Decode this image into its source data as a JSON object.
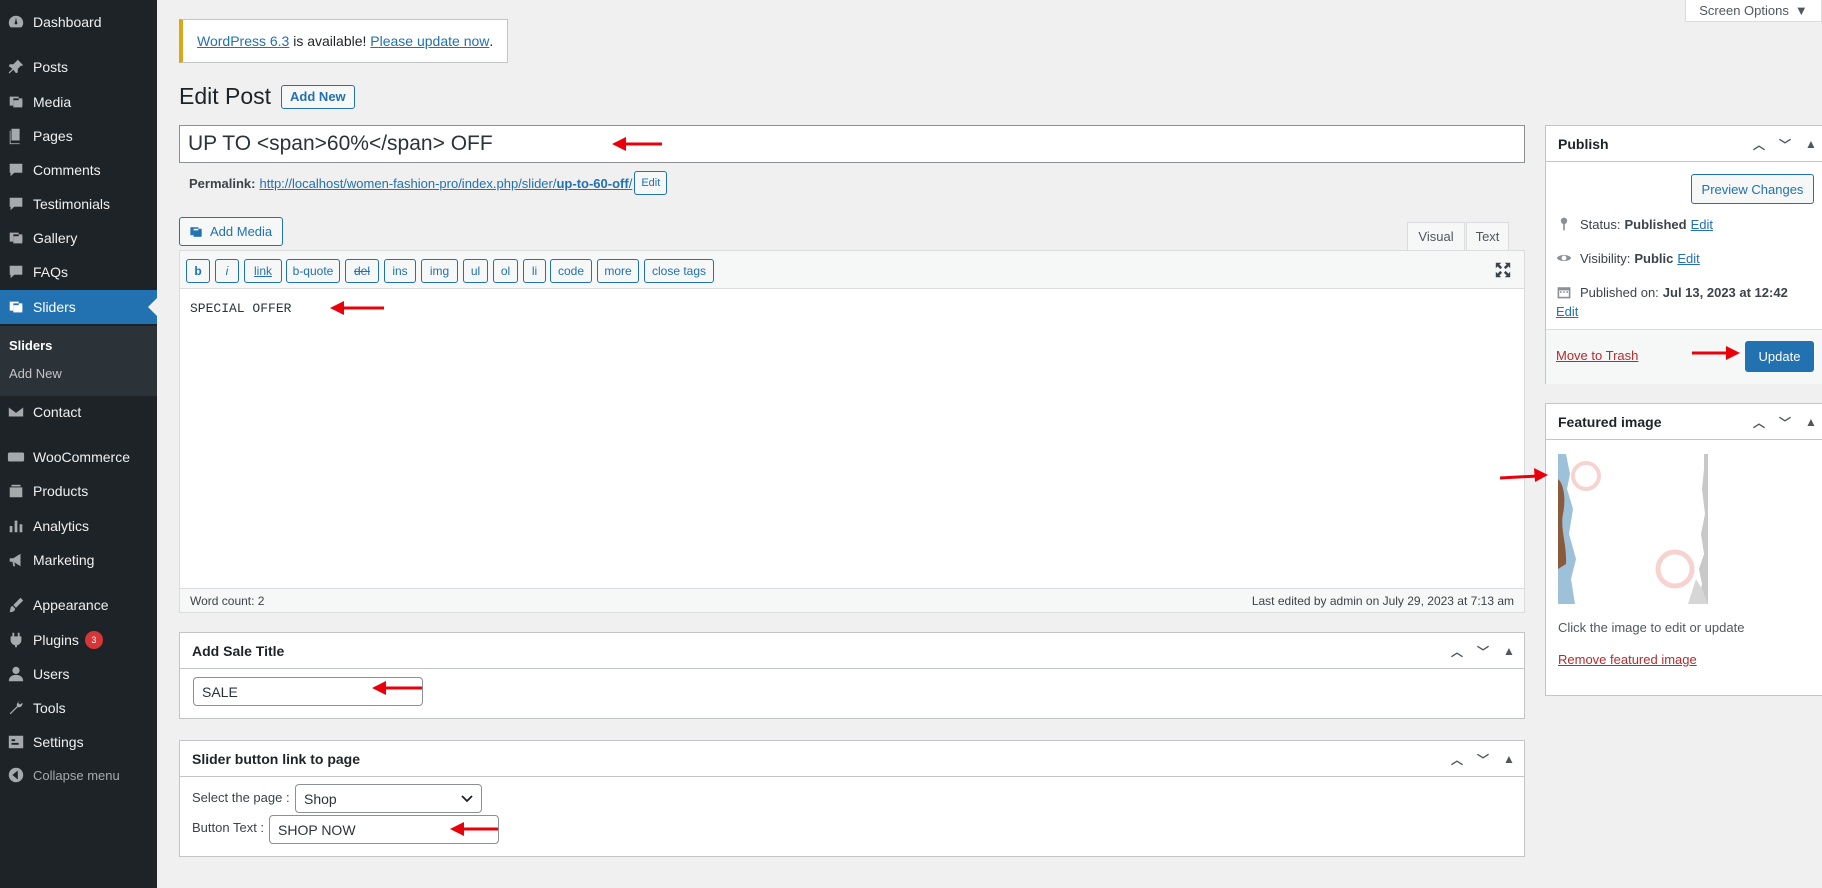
{
  "sidebar": {
    "items": [
      {
        "label": "Dashboard",
        "icon": "dashboard-icon"
      },
      {
        "label": "Posts",
        "icon": "pin-icon"
      },
      {
        "label": "Media",
        "icon": "media-icon"
      },
      {
        "label": "Pages",
        "icon": "pages-icon"
      },
      {
        "label": "Comments",
        "icon": "comments-icon"
      },
      {
        "label": "Testimonials",
        "icon": "testimonials-icon"
      },
      {
        "label": "Gallery",
        "icon": "gallery-icon"
      },
      {
        "label": "FAQs",
        "icon": "faqs-icon"
      },
      {
        "label": "Sliders",
        "icon": "sliders-icon"
      },
      {
        "label": "Contact",
        "icon": "mail-icon"
      },
      {
        "label": "WooCommerce",
        "icon": "woo-icon"
      },
      {
        "label": "Products",
        "icon": "products-icon"
      },
      {
        "label": "Analytics",
        "icon": "analytics-icon"
      },
      {
        "label": "Marketing",
        "icon": "megaphone-icon"
      },
      {
        "label": "Appearance",
        "icon": "brush-icon"
      },
      {
        "label": "Plugins",
        "icon": "plugin-icon",
        "badge": "3"
      },
      {
        "label": "Users",
        "icon": "users-icon"
      },
      {
        "label": "Tools",
        "icon": "wrench-icon"
      },
      {
        "label": "Settings",
        "icon": "settings-icon"
      }
    ],
    "submenu": {
      "current": "Sliders",
      "add_new": "Add New"
    },
    "collapse": "Collapse menu"
  },
  "screen_options": "Screen Options",
  "notice": {
    "version_link": "WordPress 6.3",
    "middle": " is available! ",
    "update_link": "Please update now",
    "end": "."
  },
  "page": {
    "title": "Edit Post",
    "add_new": "Add New"
  },
  "post": {
    "title": "UP TO <span>60%</span> OFF",
    "permalink_label": "Permalink:",
    "permalink_base": "http://localhost/women-fashion-pro/index.php/slider/",
    "permalink_slug": "up-to-60-off",
    "permalink_end": "/",
    "permalink_edit": "Edit"
  },
  "editor": {
    "add_media": "Add Media",
    "tab_visual": "Visual",
    "tab_text": "Text",
    "quicktags": [
      "b",
      "i",
      "link",
      "b-quote",
      "del",
      "ins",
      "img",
      "ul",
      "ol",
      "li",
      "code",
      "more",
      "close tags"
    ],
    "content": "SPECIAL OFFER",
    "word_count": "Word count: 2",
    "last_edited": "Last edited by admin on July 29, 2023 at 7:13 am"
  },
  "sale_box": {
    "title": "Add Sale Title",
    "value": "SALE"
  },
  "button_box": {
    "title": "Slider button link to page",
    "select_label": "Select the page :",
    "select_value": "Shop",
    "button_label": "Button Text :",
    "button_value": "SHOP NOW"
  },
  "publish": {
    "title": "Publish",
    "preview": "Preview Changes",
    "status_label": "Status:",
    "status_value": "Published",
    "visibility_label": "Visibility:",
    "visibility_value": "Public",
    "published_label": "Published on:",
    "published_value": "Jul 13, 2023 at 12:42",
    "edit": "Edit",
    "trash": "Move to Trash",
    "update": "Update"
  },
  "featured": {
    "title": "Featured image",
    "hint": "Click the image to edit or update",
    "remove": "Remove featured image"
  },
  "colors": {
    "accent": "#2271b1",
    "sidebar": "#1d2327",
    "annotation": "#e8000b"
  }
}
